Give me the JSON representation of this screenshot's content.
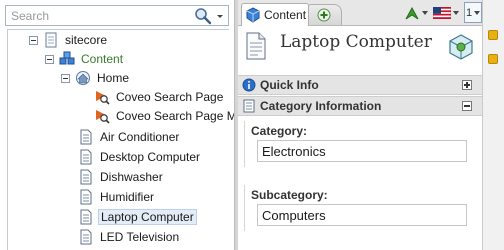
{
  "search": {
    "placeholder": "Search",
    "value": ""
  },
  "tree": {
    "nodes": [
      {
        "label": "sitecore",
        "icon": "sitecore-icon"
      },
      {
        "label": "Content",
        "icon": "content-cubes-icon"
      },
      {
        "label": "Home",
        "icon": "home-icon"
      },
      {
        "label": "Coveo Search Page",
        "icon": "search-page-icon"
      },
      {
        "label": "Coveo Search Page MVC",
        "icon": "search-page-icon"
      },
      {
        "label": "Air Conditioner",
        "icon": "document-icon"
      },
      {
        "label": "Desktop Computer",
        "icon": "document-icon"
      },
      {
        "label": "Dishwasher",
        "icon": "document-icon"
      },
      {
        "label": "Humidifier",
        "icon": "document-icon"
      },
      {
        "label": "Laptop Computer",
        "icon": "document-icon",
        "selected": true
      },
      {
        "label": "LED Television",
        "icon": "document-icon"
      }
    ]
  },
  "tabs": {
    "content_label": "Content"
  },
  "toolbar": {
    "version_label": "1"
  },
  "item": {
    "title": "Laptop Computer"
  },
  "sections": {
    "quick_info": {
      "label": "Quick Info"
    },
    "category_info": {
      "label": "Category Information"
    }
  },
  "fields": {
    "category": {
      "label": "Category:",
      "value": "Electronics"
    },
    "subcategory": {
      "label": "Subcategory:",
      "value": "Computers"
    }
  },
  "colors": {
    "accent_blue": "#2a6fc9",
    "selected_bg": "#e3ecf7",
    "section_bg": "#e4e4e4",
    "gutter_yellow": "#e9b10f"
  }
}
